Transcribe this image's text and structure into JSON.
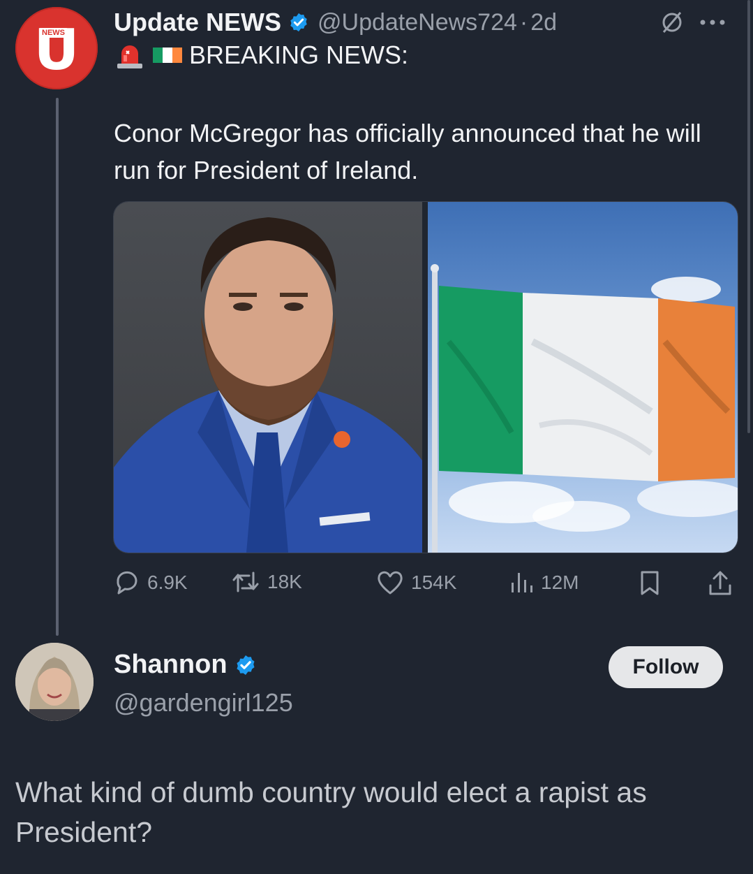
{
  "post": {
    "author_name": "Update NEWS",
    "author_handle": "@UpdateNews724",
    "separator": "·",
    "time_ago": "2d",
    "avatar_letter": "U",
    "avatar_tag": "NEWS",
    "headline": "BREAKING NEWS:",
    "body": "Conor McGregor has officially announced that he will run for President of Ireland.",
    "stats": {
      "replies": "6.9K",
      "reposts": "18K",
      "likes": "154K",
      "views": "12M"
    },
    "icons": {
      "verified": "verified-badge-icon",
      "no-reply": "slash-icon",
      "more": "more-icon",
      "siren": "siren-emoji-icon",
      "flag": "ireland-flag-emoji-icon",
      "reply": "reply-icon",
      "repost": "repost-icon",
      "like": "heart-icon",
      "views": "views-icon",
      "bookmark": "bookmark-icon",
      "share": "share-icon"
    }
  },
  "reply": {
    "author_name": "Shannon",
    "author_handle": "@gardengirl125",
    "follow_label": "Follow",
    "text": "What kind of dumb country would elect a rapist as President?"
  },
  "colors": {
    "background": "#1f2530",
    "verified": "#1d9bf0",
    "news_red": "#d9332e",
    "flag_green": "#169b62",
    "flag_white": "#ffffff",
    "flag_orange": "#ff883e"
  }
}
